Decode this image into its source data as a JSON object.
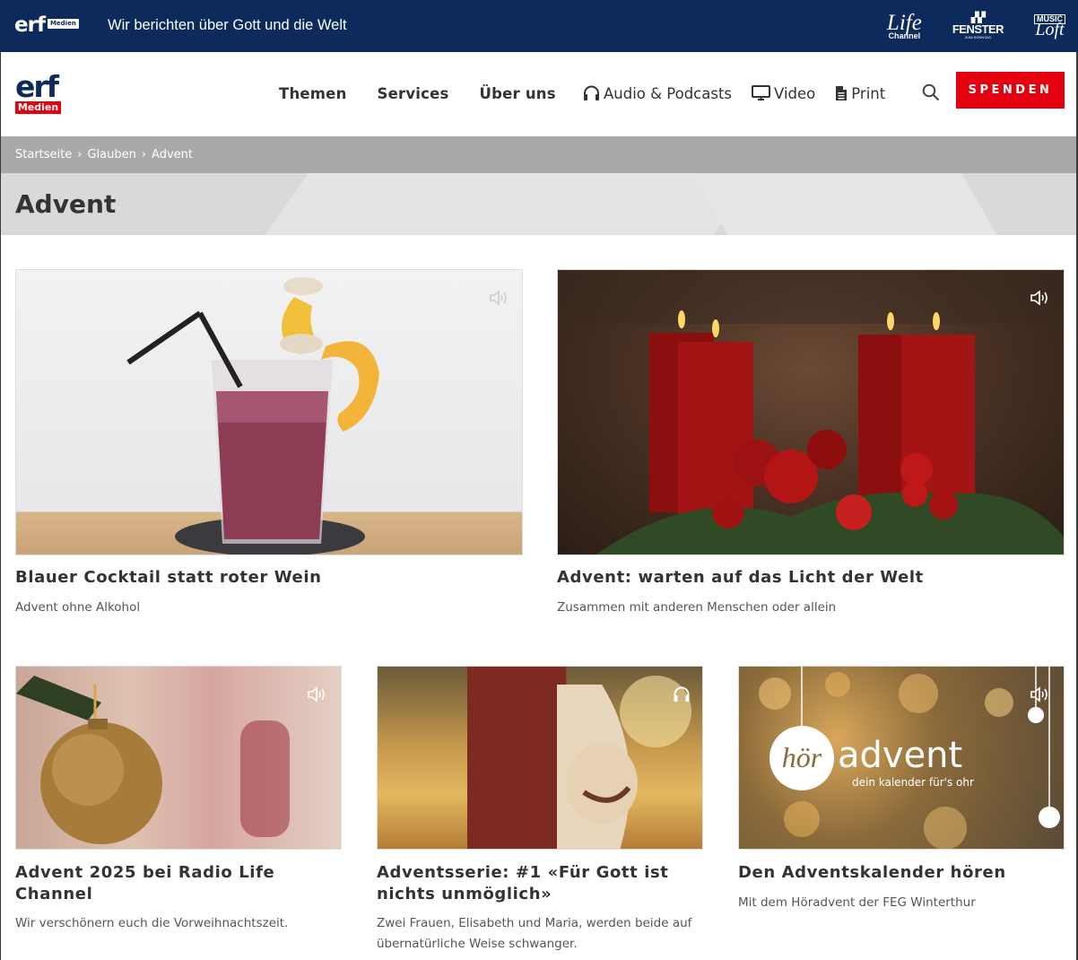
{
  "topbar": {
    "logo_text": "erf",
    "logo_badge": "Medien",
    "tagline": "Wir berichten über Gott und die Welt",
    "brands": [
      {
        "name": "Life",
        "sub": "Channel"
      },
      {
        "name": "FENSTER",
        "sub": "ZUM SONNTAG"
      },
      {
        "name": "Loft",
        "sub": "MUSIC"
      }
    ]
  },
  "header": {
    "logo_text": "erf",
    "logo_badge": "Medien",
    "nav_main": [
      "Themen",
      "Services",
      "Über uns"
    ],
    "nav_media": [
      {
        "label": "Audio & Podcasts",
        "icon": "headphones-icon"
      },
      {
        "label": "Video",
        "icon": "monitor-icon"
      },
      {
        "label": "Print",
        "icon": "document-icon"
      }
    ],
    "search_icon": "search-icon",
    "donate_label": "SPENDEN"
  },
  "breadcrumb": [
    "Startseite",
    "Glauben",
    "Advent"
  ],
  "breadcrumb_separator": "›",
  "page_title": "Advent",
  "cards": [
    {
      "title": "Blauer Cocktail statt roter Wein",
      "subtitle": "Advent ohne Alkohol",
      "media_icon": "speaker-icon",
      "image": "cocktail glass with candy garnish"
    },
    {
      "title": "Advent: warten auf das Licht der Welt",
      "subtitle": "Zusammen mit anderen Menschen oder allein",
      "media_icon": "speaker-icon",
      "image": "red advent candles"
    },
    {
      "title": "Advent 2025 bei Radio Life Channel",
      "subtitle": "Wir verschönern euch die Vorweihnachtszeit.",
      "media_icon": "speaker-icon",
      "image": "gold christmas bauble"
    },
    {
      "title": "Adventsserie: #1 «Für Gott ist nichts unmöglich»",
      "subtitle": "Zwei Frauen, Elisabeth und Maria, werden beide auf übernatürliche Weise schwanger.",
      "media_icon": "headphones-icon",
      "image": "pregnant woman in field"
    },
    {
      "title": "Den Adventskalender hören",
      "subtitle": "Mit dem Höradvent der FEG Winterthur",
      "media_icon": "speaker-icon",
      "image": "höradvent bokeh graphic",
      "image_text_1": "hör",
      "image_text_2": "advent",
      "image_text_3": "dein kalender für's ohr"
    }
  ],
  "colors": {
    "navy": "#0d2a5c",
    "red": "#e3000f",
    "text": "#333333"
  }
}
